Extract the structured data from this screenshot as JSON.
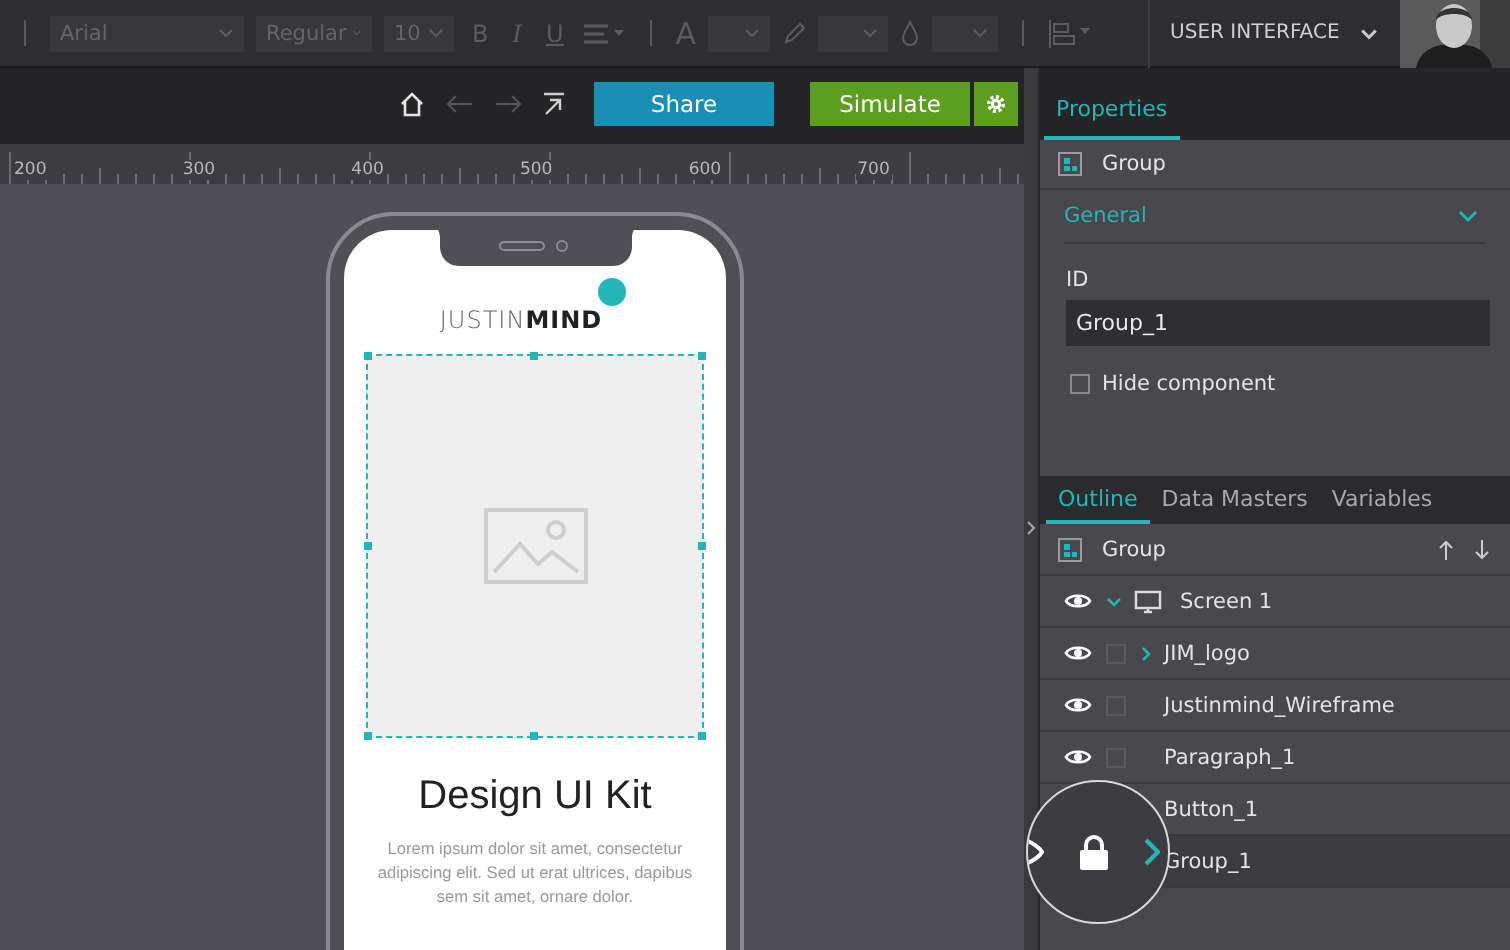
{
  "toolbar": {
    "font": "Arial",
    "weight": "Regular",
    "size": "10",
    "styles": [
      "B",
      "I",
      "U"
    ],
    "text_color_label": "A",
    "project": "USER INTERFACE"
  },
  "nav": {
    "share": "Share",
    "simulate": "Simulate"
  },
  "ruler": {
    "labels": [
      "200",
      "300",
      "400",
      "500",
      "600",
      "700"
    ]
  },
  "canvas": {
    "logo_light": "JUSTIN",
    "logo_bold": "MIND",
    "title": "Design UI Kit",
    "paragraph": "Lorem ipsum dolor sit amet, consectetur adipiscing elit. Sed ut erat ultrices, dapibus sem sit amet, ornare dolor."
  },
  "properties": {
    "tabs": [
      {
        "label": "Properties",
        "selected": true
      }
    ],
    "header": "Group",
    "section": {
      "label": "General",
      "expanded": true
    },
    "id_label": "ID",
    "id_value": "Group_1",
    "hide_component": {
      "label": "Hide component",
      "checked": false
    }
  },
  "outline": {
    "tabs": [
      {
        "label": "Outline",
        "selected": true
      },
      {
        "label": "Data Masters",
        "selected": false
      },
      {
        "label": "Variables",
        "selected": false
      }
    ],
    "header": "Group",
    "rows": [
      {
        "name": "Screen 1",
        "eye": true,
        "expanded": true,
        "selected": false,
        "children": [
          {
            "name": "JIM_logo",
            "eye": true,
            "checked": false,
            "expanded": false,
            "selected": false
          },
          {
            "name": "Justinmind_Wireframe",
            "eye": true,
            "checked": false,
            "selected": false
          },
          {
            "name": "Paragraph_1",
            "eye": true,
            "checked": false,
            "selected": false
          },
          {
            "name": "Button_1",
            "selected": false
          },
          {
            "name": "Group_1",
            "selected": true
          }
        ]
      }
    ]
  }
}
